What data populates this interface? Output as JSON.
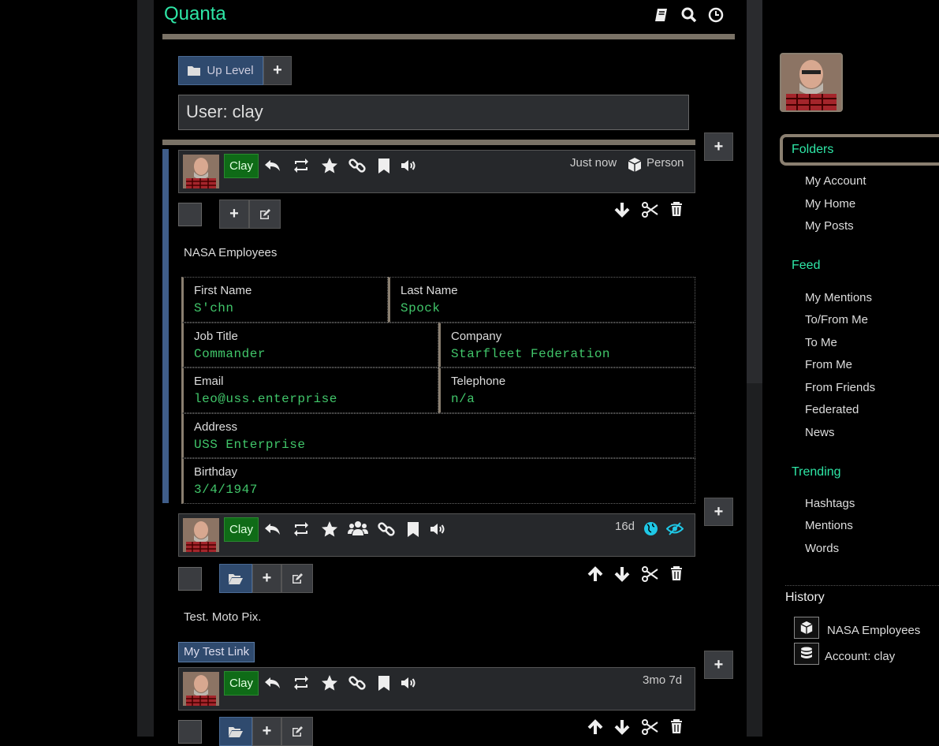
{
  "app": {
    "title": "Quanta"
  },
  "toolbar": {
    "up_level": "Up Level"
  },
  "page_title": "User: clay",
  "nodes": [
    {
      "author": "Clay",
      "time": "Just now",
      "type_label": "Person",
      "text": "NASA Employees",
      "fields": [
        {
          "label": "First Name",
          "value": "S'chn"
        },
        {
          "label": "Last Name",
          "value": "Spock"
        },
        {
          "label": "Job Title",
          "value": "Commander"
        },
        {
          "label": "Company",
          "value": "Starfleet Federation"
        },
        {
          "label": "Email",
          "value": "leo@uss.enterprise"
        },
        {
          "label": "Telephone",
          "value": "n/a"
        },
        {
          "label": "Address",
          "value": "USS Enterprise"
        },
        {
          "label": "Birthday",
          "value": "3/4/1947"
        }
      ]
    },
    {
      "author": "Clay",
      "time": "16d",
      "text": "Test. Moto Pix.",
      "link_label": "My Test Link"
    },
    {
      "author": "Clay",
      "time": "3mo 7d"
    }
  ],
  "sidebar": {
    "folders_title": "Folders",
    "folders": [
      "My Account",
      "My Home",
      "My Posts"
    ],
    "feed_title": "Feed",
    "feed": [
      "My Mentions",
      "To/From Me",
      "To Me",
      "From Me",
      "From Friends",
      "Federated",
      "News"
    ],
    "trending_title": "Trending",
    "trending": [
      "Hashtags",
      "Mentions",
      "Words"
    ],
    "history_title": "History",
    "history": [
      "NASA Employees",
      "Account: clay"
    ]
  },
  "colors": {
    "accent": "#2ee6a6",
    "badge": "#0f6b17",
    "prop_value": "#41c66a",
    "blue_button": "#2f4a6e"
  }
}
